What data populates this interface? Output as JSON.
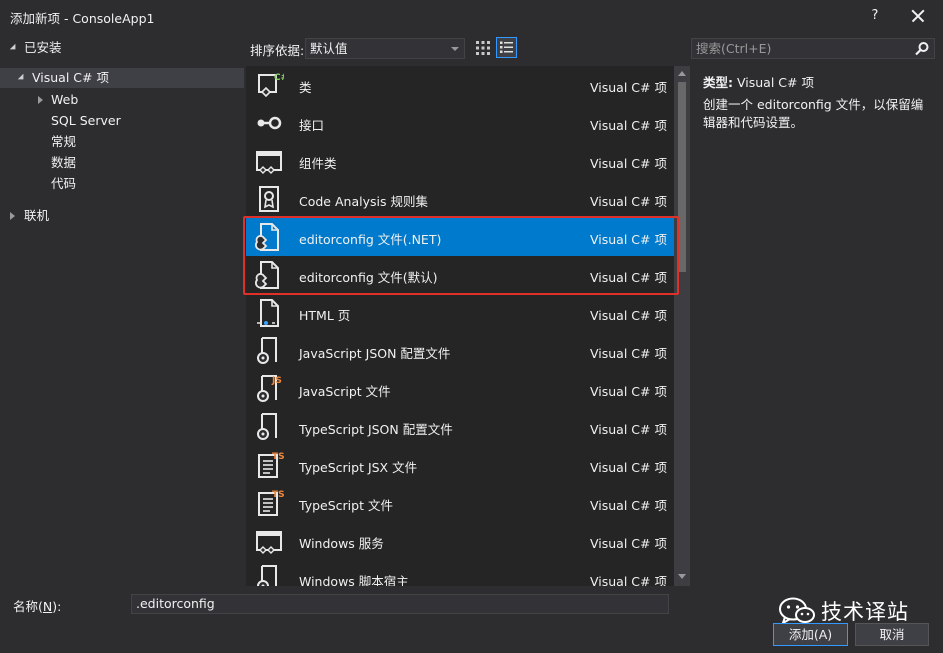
{
  "window": {
    "title": "添加新项 - ConsoleApp1",
    "help_label": "?"
  },
  "tree": {
    "installed_label": "已安装",
    "root_label": "Visual C# 项",
    "children": [
      "Web",
      "SQL Server",
      "常规",
      "数据",
      "代码"
    ],
    "online_label": "联机"
  },
  "toolbar": {
    "sort_label": "排序依据:",
    "sort_value": "默认值",
    "search_placeholder": "搜索(Ctrl+E)"
  },
  "templates": [
    {
      "name": "类",
      "type": "Visual C# 项",
      "icon": "class-icon"
    },
    {
      "name": "接口",
      "type": "Visual C# 项",
      "icon": "interface-icon"
    },
    {
      "name": "组件类",
      "type": "Visual C# 项",
      "icon": "component-class-icon"
    },
    {
      "name": "Code Analysis 规则集",
      "type": "Visual C# 项",
      "icon": "ruleset-icon"
    },
    {
      "name": "editorconfig 文件(.NET)",
      "type": "Visual C# 项",
      "icon": "editorconfig-icon",
      "selected": true
    },
    {
      "name": "editorconfig 文件(默认)",
      "type": "Visual C# 项",
      "icon": "editorconfig-icon"
    },
    {
      "name": "HTML 页",
      "type": "Visual C# 项",
      "icon": "html-page-icon"
    },
    {
      "name": "JavaScript JSON 配置文件",
      "type": "Visual C# 项",
      "icon": "json-config-icon"
    },
    {
      "name": "JavaScript 文件",
      "type": "Visual C# 项",
      "icon": "javascript-file-icon",
      "badge": "JS"
    },
    {
      "name": "TypeScript JSON 配置文件",
      "type": "Visual C# 项",
      "icon": "json-config-icon"
    },
    {
      "name": "TypeScript JSX 文件",
      "type": "Visual C# 项",
      "icon": "typescript-jsx-icon",
      "badge": "TS"
    },
    {
      "name": "TypeScript 文件",
      "type": "Visual C# 项",
      "icon": "typescript-file-icon",
      "badge": "TS"
    },
    {
      "name": "Windows 服务",
      "type": "Visual C# 项",
      "icon": "windows-service-icon"
    },
    {
      "name": "Windows 脚本宿主",
      "type": "Visual C# 项",
      "icon": "script-host-icon"
    }
  ],
  "details": {
    "type_label": "类型:",
    "type_value": "Visual C# 项",
    "description": "创建一个 editorconfig 文件，以保留编辑器和代码设置。"
  },
  "bottom": {
    "name_label_prefix": "名称(",
    "name_label_key": "N",
    "name_label_suffix": "):",
    "name_value": ".editorconfig",
    "watermark": "技术译站",
    "add_label": "添加(A)",
    "cancel_label": "取消"
  },
  "colors": {
    "background": "#2d2d30",
    "list_background": "#252526",
    "selection": "#007acc",
    "highlight_box": "#e0302a",
    "badge_orange": "#f0883a",
    "badge_green": "#8bd36a"
  }
}
